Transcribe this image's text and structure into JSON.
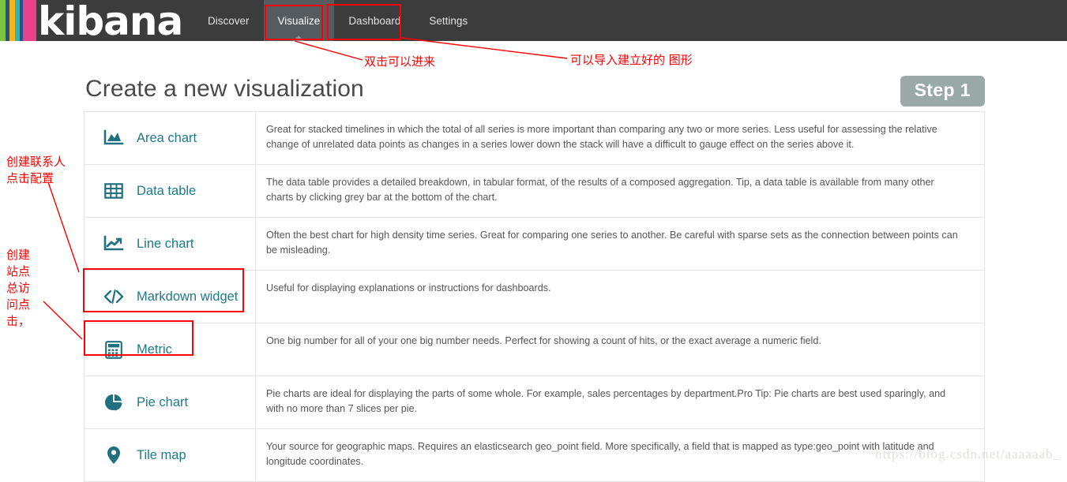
{
  "brand": {
    "name": "kibana",
    "logo_colors": [
      "#7cc243",
      "#2a4d8f",
      "#f5b51a",
      "#38b2ac",
      "#2a4d8f",
      "#e8438a"
    ]
  },
  "nav": {
    "tabs": [
      {
        "label": "Discover",
        "active": false
      },
      {
        "label": "Visualize",
        "active": true
      },
      {
        "label": "Dashboard",
        "active": false
      },
      {
        "label": "Settings",
        "active": false
      }
    ]
  },
  "page": {
    "title": "Create a new visualization",
    "step_badge": "Step 1"
  },
  "vis_types": [
    {
      "icon": "area-chart-icon",
      "label": "Area chart",
      "description": "Great for stacked timelines in which the total of all series is more important than comparing any two or more series. Less useful for assessing the relative change of unrelated data points as changes in a series lower down the stack will have a difficult to gauge effect on the series above it."
    },
    {
      "icon": "data-table-icon",
      "label": "Data table",
      "description": "The data table provides a detailed breakdown, in tabular format, of the results of a composed aggregation. Tip, a data table is available from many other charts by clicking grey bar at the bottom of the chart."
    },
    {
      "icon": "line-chart-icon",
      "label": "Line chart",
      "description": "Often the best chart for high density time series. Great for comparing one series to another. Be careful with sparse sets as the connection between points can be misleading."
    },
    {
      "icon": "markdown-code-icon",
      "label": "Markdown widget",
      "description": "Useful for displaying explanations or instructions for dashboards."
    },
    {
      "icon": "metric-calculator-icon",
      "label": "Metric",
      "description": "One big number for all of your one big number needs. Perfect for showing a count of hits, or the exact average a numeric field."
    },
    {
      "icon": "pie-chart-icon",
      "label": "Pie chart",
      "description": "Pie charts are ideal for displaying the parts of some whole. For example, sales percentages by department.Pro Tip: Pie charts are best used sparingly, and with no more than 7 slices per pie."
    },
    {
      "icon": "tile-map-pin-icon",
      "label": "Tile map",
      "description": "Your source for geographic maps. Requires an elasticsearch geo_point field. More specifically, a field that is mapped as type:geo_point with latitude and longitude coordinates."
    }
  ],
  "annotations": {
    "color": "#ff0000",
    "visualize_note": "双击可以进来",
    "dashboard_note": "可以导入建立好的 图形",
    "left_note_top": "创建联系人\n点击配置",
    "left_note_bottom": "创建\n站点\n总访\n问点\n击，"
  },
  "watermark": "https://blog.csdn.net/aaaaaab_"
}
